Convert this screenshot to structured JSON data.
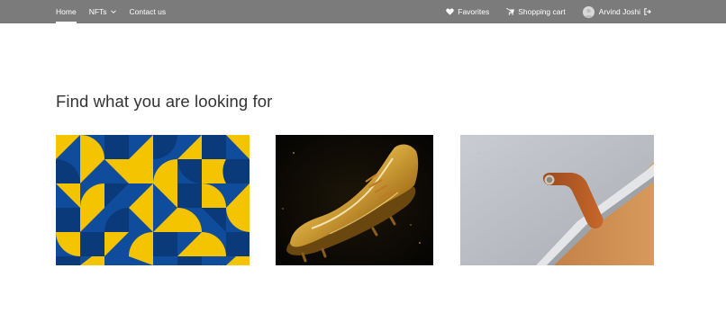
{
  "nav": {
    "links": [
      {
        "label": "Home",
        "active": true
      },
      {
        "label": "NFTs",
        "dropdown": true
      },
      {
        "label": "Contact us"
      }
    ],
    "favorites_label": "Favorites",
    "cart_label": "Shopping cart",
    "user_name": "Arvind Joshi"
  },
  "main": {
    "heading": "Find what you are looking for"
  },
  "gallery": [
    {
      "image": "geometric-pattern-nft"
    },
    {
      "image": "golden-sneaker-nft"
    },
    {
      "image": "felt-laptop-sleeve-nft"
    }
  ],
  "colors": {
    "navbar": "#7b7b7b",
    "pattern_blue": "#0f4c9c",
    "pattern_dark": "#0b3a7a",
    "pattern_yellow": "#f5c400"
  }
}
